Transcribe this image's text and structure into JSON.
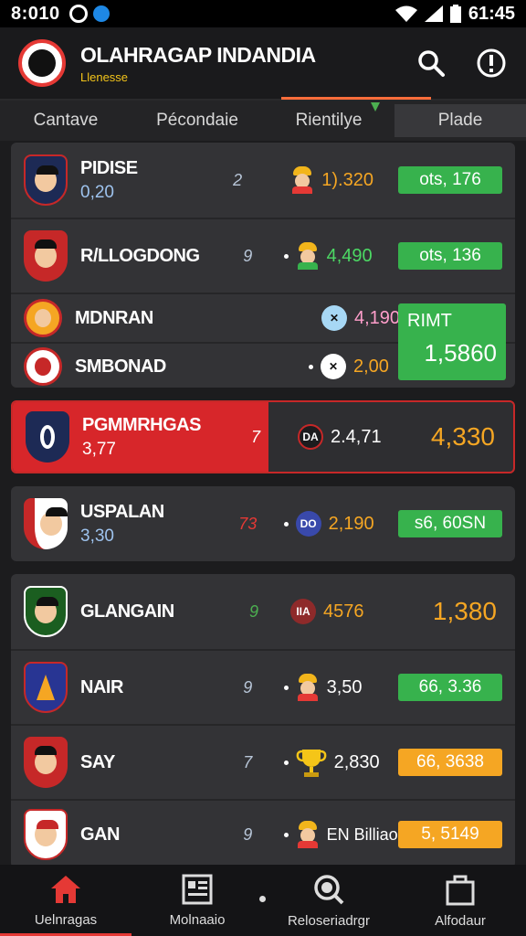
{
  "status": {
    "time": "8:010",
    "battery": "61:45"
  },
  "header": {
    "title": "OLAHRAGAP INDANDIA",
    "subtitle": "Llenesse"
  },
  "tabs": [
    "Cantave",
    "Pécondaie",
    "Rientilye",
    "Plade"
  ],
  "rows": [
    {
      "name": "PIDISE",
      "sub": "0,20",
      "count": "2",
      "value": "1).320",
      "value_color": "#f5a623",
      "pill": "ots,  176",
      "pill_color": "green"
    },
    {
      "name": "R/LLOGDONG",
      "sub": "",
      "count": "9",
      "value": "4,490",
      "value_color": "#4cd964",
      "pill": "ots,  136",
      "pill_color": "green"
    },
    {
      "name": "MDNRAN",
      "sub": "",
      "count": "",
      "value": "4,190",
      "value_color": "#ff9ecb",
      "pill": "",
      "pill_color": ""
    },
    {
      "name": "SMBONAD",
      "sub": "",
      "count": "",
      "value": "2,00",
      "value_color": "#f5a623",
      "pill": "",
      "pill_color": ""
    },
    {
      "name": "PGMMRHGAS",
      "sub": "3,77",
      "count": "7",
      "value": "2.4,71",
      "value_color": "#ffffff",
      "big": "4,330"
    },
    {
      "name": "USPALAN",
      "sub": "3,30",
      "count": "73",
      "value": "2,190",
      "value_color": "#f5a623",
      "pill": "s6, 60SN",
      "pill_color": "green"
    },
    {
      "name": "GLANGAIN",
      "sub": "",
      "count": "9",
      "value": "4576",
      "value_color": "#f5a623",
      "big": "1,380"
    },
    {
      "name": "NAIR",
      "sub": "",
      "count": "9",
      "value": "3,50",
      "value_color": "#ffffff",
      "pill": "66, 3.36",
      "pill_color": "green"
    },
    {
      "name": "SAY",
      "sub": "",
      "count": "7",
      "value": "2,830",
      "value_color": "#ffffff",
      "pill": "66, 3638",
      "pill_color": "yellow"
    },
    {
      "name": "GAN",
      "sub": "",
      "count": "9",
      "value": "EN Billiao",
      "value_color": "#ffffff",
      "pill": "5, 5149",
      "pill_color": "yellow"
    }
  ],
  "combined_box": {
    "label": "RIMT",
    "value": "1,5860"
  },
  "ball_labels": {
    "r5": "DA",
    "r6": "DO",
    "r7": "IIA"
  },
  "nav": [
    "Uelnragas",
    "Molnaaio",
    "Reloseriadrgr",
    "Alfodaur"
  ]
}
